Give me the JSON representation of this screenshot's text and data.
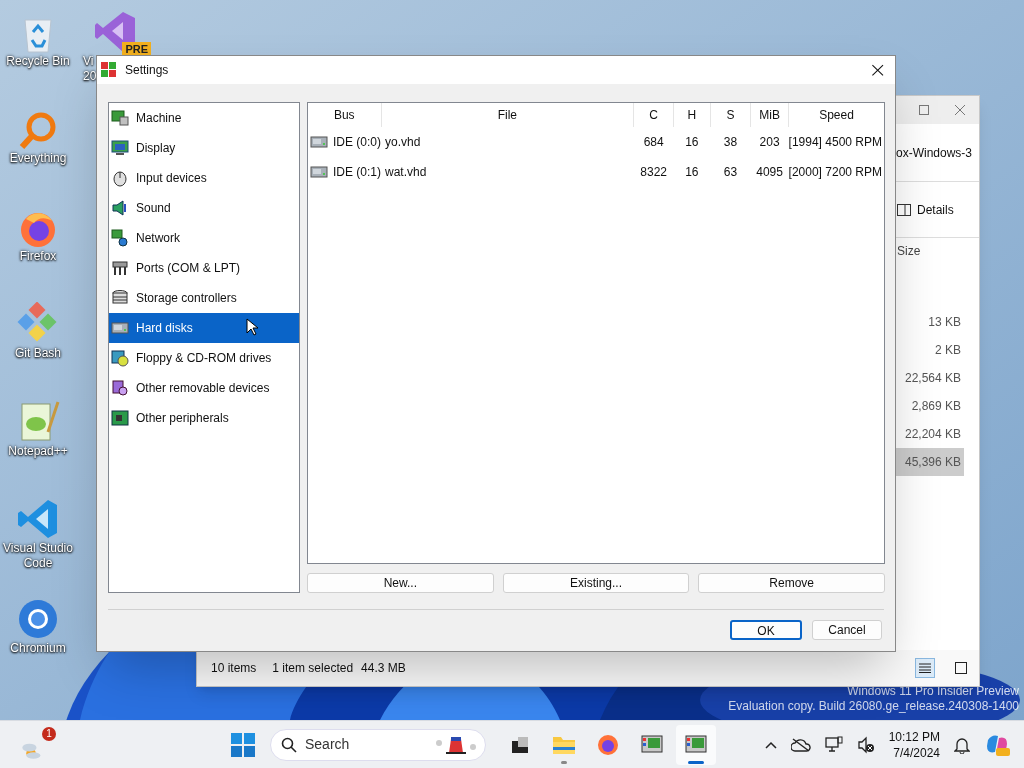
{
  "desktop_icons": [
    {
      "kind": "recycle",
      "lines": [
        "Recycle Bin"
      ]
    },
    {
      "kind": "everything",
      "lines": [
        "Everything"
      ]
    },
    {
      "kind": "firefox",
      "lines": [
        "Firefox"
      ]
    },
    {
      "kind": "git",
      "lines": [
        "Git Bash"
      ]
    },
    {
      "kind": "notepad",
      "lines": [
        "Notepad++"
      ]
    },
    {
      "kind": "vscode",
      "lines": [
        "Visual Studio",
        "Code"
      ]
    },
    {
      "kind": "chromium",
      "lines": [
        "Chromium"
      ]
    },
    {
      "kind": "vs",
      "lines": [
        "Vi",
        "20"
      ],
      "badge": "PRE"
    }
  ],
  "watermark": [
    "Windows 11 Pro Insider Preview",
    "Evaluation copy. Build 26080.ge_release.240308-1400"
  ],
  "explorer": {
    "title": "ox-Windows-3",
    "view_button": "Details",
    "column": "Size",
    "sizes": [
      {
        "text": "13 KB",
        "selected": false
      },
      {
        "text": "2 KB",
        "selected": false
      },
      {
        "text": "22,564 KB",
        "selected": false
      },
      {
        "text": "2,869 KB",
        "selected": false
      },
      {
        "text": "22,204 KB",
        "selected": false
      },
      {
        "text": "45,396 KB",
        "selected": true
      }
    ],
    "status": {
      "items": "10 items",
      "selection": "1 item selected",
      "size": "44.3 MB"
    },
    "views": [
      {
        "kind": "details",
        "selected": true
      },
      {
        "kind": "tiles",
        "selected": false
      }
    ]
  },
  "dialog": {
    "title": "Settings",
    "close": "×",
    "categories": [
      {
        "kind": "machine",
        "label": "Machine",
        "selected": false
      },
      {
        "kind": "display",
        "label": "Display",
        "selected": false
      },
      {
        "kind": "input",
        "label": "Input devices",
        "selected": false
      },
      {
        "kind": "sound",
        "label": "Sound",
        "selected": false
      },
      {
        "kind": "network",
        "label": "Network",
        "selected": false
      },
      {
        "kind": "ports",
        "label": "Ports (COM & LPT)",
        "selected": false
      },
      {
        "kind": "storage",
        "label": "Storage controllers",
        "selected": false
      },
      {
        "kind": "harddisk",
        "label": "Hard disks",
        "selected": true
      },
      {
        "kind": "floppy",
        "label": "Floppy & CD-ROM drives",
        "selected": false
      },
      {
        "kind": "removable",
        "label": "Other removable devices",
        "selected": false
      },
      {
        "kind": "peripherals",
        "label": "Other peripherals",
        "selected": false
      }
    ],
    "columns": [
      "Bus",
      "File",
      "C",
      "H",
      "S",
      "MiB",
      "Speed"
    ],
    "disks": [
      {
        "bus": "IDE (0:0)",
        "file": "yo.vhd",
        "c": "684",
        "h": "16",
        "s": "38",
        "mib": "203",
        "speed": "[1994] 4500 RPM"
      },
      {
        "bus": "IDE (0:1)",
        "file": "wat.vhd",
        "c": "8322",
        "h": "16",
        "s": "63",
        "mib": "4095",
        "speed": "[2000] 7200 RPM"
      }
    ],
    "buttons": [
      "New...",
      "Existing...",
      "Remove"
    ],
    "ok": "OK",
    "cancel": "Cancel"
  },
  "taskbar": {
    "weather_badge": "1",
    "search": "Search",
    "apps": [
      {
        "kind": "taskview",
        "running": false,
        "active": false
      },
      {
        "kind": "explorer",
        "running": true,
        "active": false
      },
      {
        "kind": "firefox",
        "running": false,
        "active": false
      },
      {
        "kind": "emulator",
        "running": false,
        "active": false
      },
      {
        "kind": "emulator",
        "running": true,
        "active": true
      }
    ],
    "time": "10:12 PM",
    "date": "7/4/2024"
  }
}
